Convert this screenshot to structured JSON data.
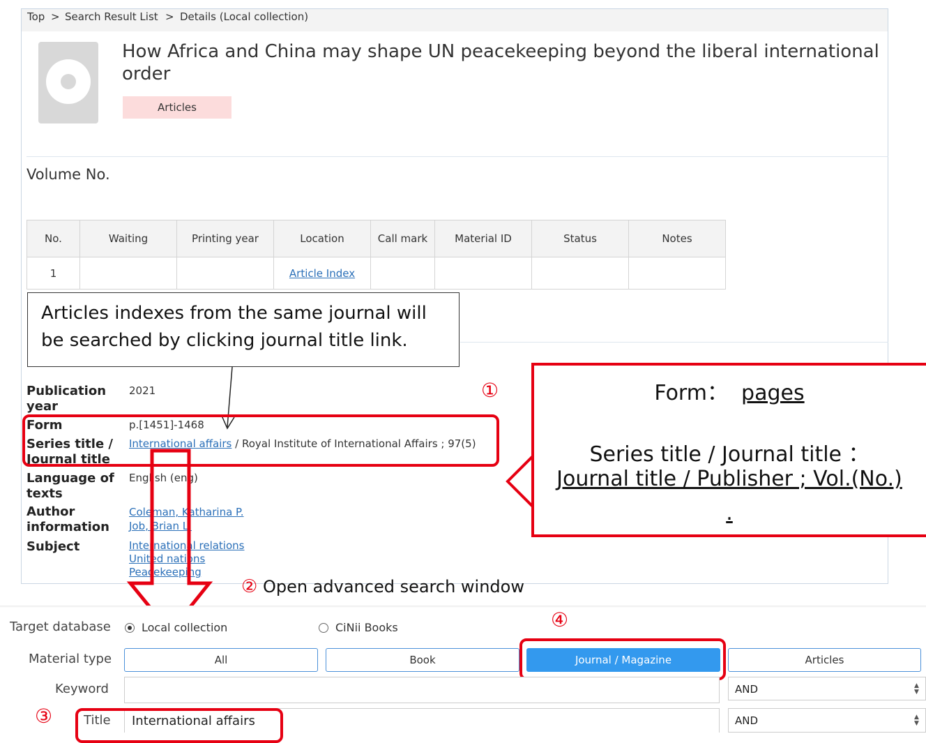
{
  "breadcrumb": {
    "items": [
      "Top",
      "Search Result List",
      "Details (Local collection)"
    ],
    "separator": ">"
  },
  "record": {
    "title": "How Africa and China may shape UN peacekeeping beyond the liberal international order",
    "material_badge": "Articles"
  },
  "volume_section": {
    "heading": "Volume No.",
    "columns": [
      "No.",
      "Waiting",
      "Printing year",
      "Location",
      "Call mark",
      "Material ID",
      "Status",
      "Notes"
    ],
    "rows": [
      [
        "1",
        "",
        "",
        "Article Index",
        "",
        "",
        "",
        ""
      ]
    ]
  },
  "callout_top": {
    "line1": "Articles indexes from the same journal will",
    "line2": "be searched by clicking journal title link."
  },
  "details": {
    "publication_year_label": "Publication year",
    "publication_year": "2021",
    "form_label": "Form",
    "form_value": "p.[1451]-1468",
    "series_label": "Series title / Journal title",
    "series_link": "International affairs",
    "series_rest": "/ Royal Institute of International Affairs ; 97(5)",
    "language_label": "Language of texts",
    "language_value": "English (eng)",
    "author_label": "Author information",
    "authors": [
      "Coleman, Katharina P.",
      "Job, Brian L."
    ],
    "subject_label": "Subject",
    "subjects": [
      "International relations",
      "United nations",
      "Peacekeeping"
    ]
  },
  "annotations": {
    "marker_1": "①",
    "marker_2": "②",
    "marker_2_text": "Open advanced search window",
    "marker_3": "③",
    "marker_4": "④",
    "accent_color": "#e60012"
  },
  "callout_right": {
    "form_prefix": "Form：",
    "form_value": "pages",
    "series_line": "Series title / Journal title ：",
    "series_format": "Journal title / Publisher ; Vol.(No.)",
    "dot": "."
  },
  "advanced_search": {
    "target_db_label": "Target database",
    "db_options": [
      "Local collection",
      "CiNii Books"
    ],
    "selected_db": "Local collection",
    "material_type_label": "Material type",
    "material_types": [
      "All",
      "Book",
      "Journal / Magazine",
      "Articles"
    ],
    "selected_material": "Journal / Magazine",
    "keyword_label": "Keyword",
    "keyword_value": "",
    "keyword_operator": "AND",
    "title_label": "Title",
    "title_value": "International affairs",
    "title_operator": "AND",
    "active_color": "#3399ee"
  }
}
